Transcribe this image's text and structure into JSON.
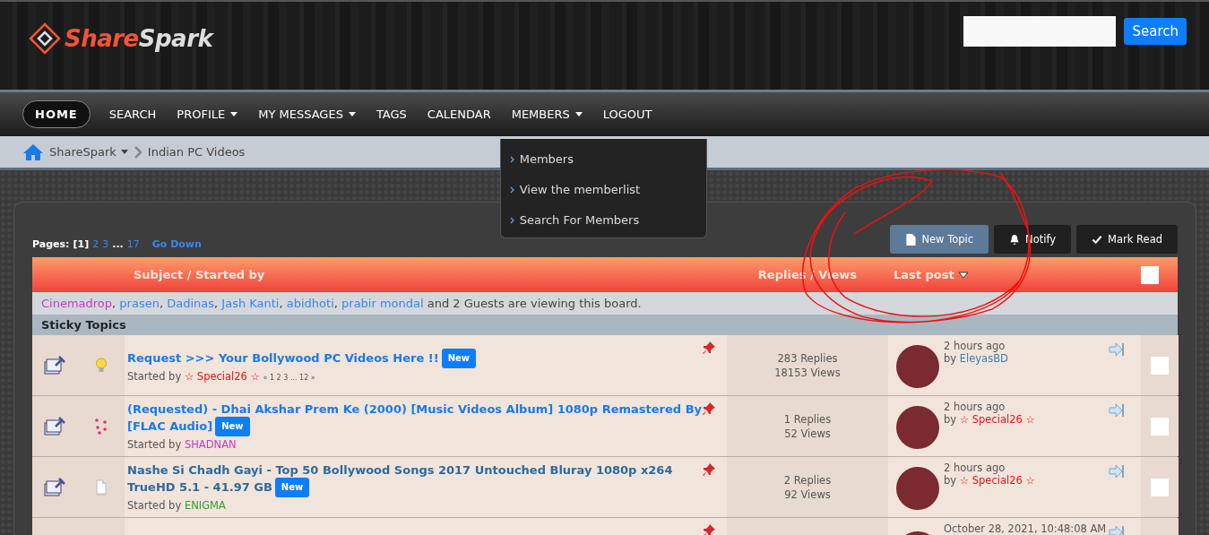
{
  "header": {
    "logo_text": [
      "Share",
      "Spark"
    ],
    "search_button": "Search"
  },
  "nav": {
    "items": [
      {
        "label": "HOME",
        "selected": true,
        "has_menu": false
      },
      {
        "label": "SEARCH",
        "selected": false,
        "has_menu": false
      },
      {
        "label": "PROFILE",
        "selected": false,
        "has_menu": true
      },
      {
        "label": "MY MESSAGES",
        "selected": false,
        "has_menu": true
      },
      {
        "label": "TAGS",
        "selected": false,
        "has_menu": false
      },
      {
        "label": "CALENDAR",
        "selected": false,
        "has_menu": false
      },
      {
        "label": "MEMBERS",
        "selected": false,
        "has_menu": true,
        "menu": [
          "Members",
          "View the memberlist",
          "Search For Members"
        ]
      },
      {
        "label": "LOGOUT",
        "selected": false,
        "has_menu": false
      }
    ]
  },
  "breadcrumb": [
    {
      "label": "ShareSpark",
      "has_menu": true
    },
    {
      "label": "Indian PC Videos",
      "has_menu": false
    }
  ],
  "pagination": {
    "label": "Pages:",
    "pages": [
      {
        "label": "[1]",
        "kind": "current"
      },
      {
        "label": "2",
        "kind": "link"
      },
      {
        "label": "3",
        "kind": "link"
      },
      {
        "label": "...",
        "kind": "gap"
      },
      {
        "label": "17",
        "kind": "link"
      }
    ],
    "go_down": "Go Down"
  },
  "actions": [
    {
      "label": "New Topic",
      "highlighted": true
    },
    {
      "label": "Notify",
      "highlighted": false
    },
    {
      "label": "Mark Read",
      "highlighted": false
    }
  ],
  "table": {
    "columns": [
      {
        "label": "Subject / Started by",
        "sorted": false
      },
      {
        "label": "Replies / Views",
        "sorted": false
      },
      {
        "label": "Last post",
        "sorted": true
      }
    ],
    "all_checked": false
  },
  "viewing": {
    "users": [
      {
        "name": "Cinemadrop",
        "separator": ",",
        "color": "#c03bc0"
      },
      {
        "name": "prasen",
        "separator": ",",
        "color": "#3a86e8"
      },
      {
        "name": "Dadinas",
        "separator": ",",
        "color": "#3a86e8"
      },
      {
        "name": "Jash Kanti",
        "separator": ",",
        "color": "#3a86e8"
      },
      {
        "name": "abidhoti",
        "separator": ",",
        "color": "#3a86e8"
      },
      {
        "name": "prabir mondal",
        "color": "#3a86e8"
      }
    ],
    "suffix": "and 2 Guests are viewing this board."
  },
  "section_title": "Sticky Topics",
  "topics": [
    {
      "kind": "idea",
      "title": "Request >>> Your Bollywood PC Videos Here !!",
      "visited": false,
      "new_badge": "New",
      "started_by_label": "Started by",
      "starter": {
        "name": "☆ Special26 ☆",
        "color": "#e8141c"
      },
      "pages": "« 1 2 3 ... 12 »",
      "replies": "283 Replies",
      "views": "18153 Views",
      "last_time": "2 hours ago",
      "last_by_label": "by",
      "last_poster": {
        "name": "EleyasBD",
        "color": "#3a7fb8"
      },
      "checked": false
    },
    {
      "kind": "love",
      "title": "(Requested) - Dhai Akshar Prem Ke (2000) [Music Videos Album] 1080p Remastered By [FLAC Audio]",
      "visited": false,
      "new_badge": "New",
      "started_by_label": "Started by",
      "starter": {
        "name": "SHADNAN",
        "color": "#c03bc0"
      },
      "replies": "1 Replies",
      "views": "52 Views",
      "last_time": "2 hours ago",
      "last_by_label": "by",
      "last_poster": {
        "name": "☆ Special26 ☆",
        "color": "#e8141c"
      },
      "checked": false
    },
    {
      "kind": "plain",
      "title": "Nashe Si Chadh Gayi - Top 50 Bollywood Songs 2017 Untouched Bluray 1080p x264 TrueHD 5.1 - 41.97 GB",
      "visited": true,
      "new_badge": "New",
      "started_by_label": "Started by",
      "starter": {
        "name": "ENIGMA",
        "color": "#2ca02c"
      },
      "replies": "2 Replies",
      "views": "92 Views",
      "last_time": "2 hours ago",
      "last_by_label": "by",
      "last_poster": {
        "name": "☆ Special26 ☆",
        "color": "#e8141c"
      },
      "checked": false
    },
    {
      "last_time": "October 28, 2021, 10:48:08 AM"
    }
  ]
}
